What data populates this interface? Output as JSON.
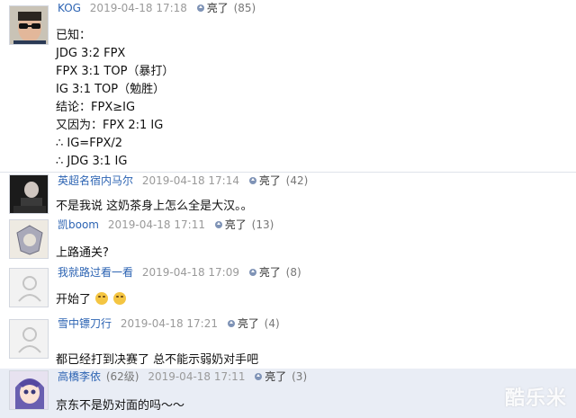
{
  "comments": [
    {
      "username": "KOG",
      "time": "2019-04-18 17:18",
      "like_label": "亮了",
      "like_count": "(85)",
      "avatar": "avatar-sunglasses-man",
      "content": [
        "已知：",
        "JDG 3:2 FPX",
        "FPX 3:1 TOP（暴打）",
        "IG 3:1 TOP（勉胜）",
        "结论：FPX≥IG",
        "又因为：FPX 2:1 IG",
        "∴ IG=FPX/2",
        "∴ JDG 3:1 IG"
      ]
    },
    {
      "username": "英超名宿内马尔",
      "time": "2019-04-18 17:14",
      "like_label": "亮了",
      "like_count": "(42)",
      "avatar": "avatar-spurs-coach",
      "content": [
        "不是我说 这奶茶身上怎么全是大汉。。"
      ]
    },
    {
      "username": "凯boom",
      "time": "2019-04-18 17:11",
      "like_label": "亮了",
      "like_count": "(13)",
      "avatar": "avatar-badge",
      "content": [
        "上路通关?"
      ]
    },
    {
      "username": "我就路过看一看",
      "time": "2019-04-18 17:09",
      "like_label": "亮了",
      "like_count": "(8)",
      "avatar": "avatar-default",
      "content": [
        "开始了"
      ]
    },
    {
      "username": "雪中镖刀行",
      "time": "2019-04-18 17:21",
      "like_label": "亮了",
      "like_count": "(4)",
      "avatar": "avatar-default",
      "content": [
        "都已经打到决赛了 总不能示弱奶对手吧"
      ]
    },
    {
      "username": "高橋李依",
      "level": "(62级)",
      "time": "2019-04-18 17:11",
      "like_label": "亮了",
      "like_count": "(3)",
      "avatar": "avatar-anime-girl",
      "content": [
        "京东不是奶对面的吗～～"
      ]
    }
  ],
  "watermark": "酷乐米",
  "colors": {
    "username": "#2d64b3",
    "header_bg": "#e9edf5",
    "time": "#9a9a9a"
  }
}
